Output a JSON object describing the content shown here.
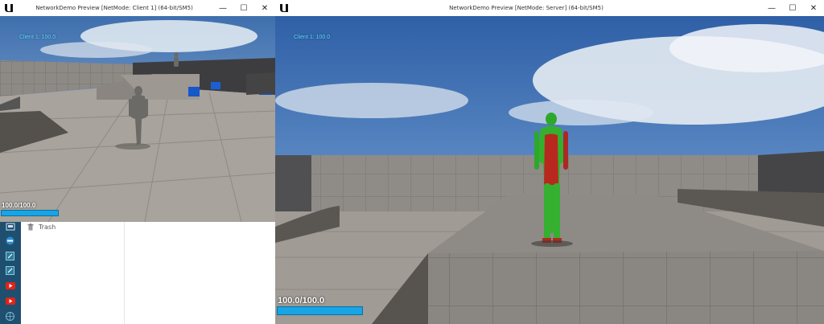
{
  "window_client": {
    "title": "NetworkDemo Preview [NetMode: Client 1]  (64-bit/SM5)",
    "hud_client": "Client 1: 100.0",
    "hp_text": "100.0/100.0",
    "hp_fraction": 1.0,
    "controls": {
      "minimize": "—",
      "maximize": "☐",
      "close": "✕"
    }
  },
  "window_server": {
    "title": "NetworkDemo Preview [NetMode: Server]  (64-bit/SM5)",
    "hud_client": "Client 1: 100.0",
    "hp_text": "100.0/100.0",
    "hp_fraction": 1.0,
    "controls": {
      "minimize": "—",
      "maximize": "☐",
      "close": "✕"
    }
  },
  "file_panel": {
    "trash_label": "Trash"
  },
  "taskbar": {
    "icons": [
      "drive-icon",
      "browser-icon",
      "edit-icon",
      "edit-icon",
      "youtube-icon",
      "youtube-icon",
      "globe-icon"
    ]
  }
}
